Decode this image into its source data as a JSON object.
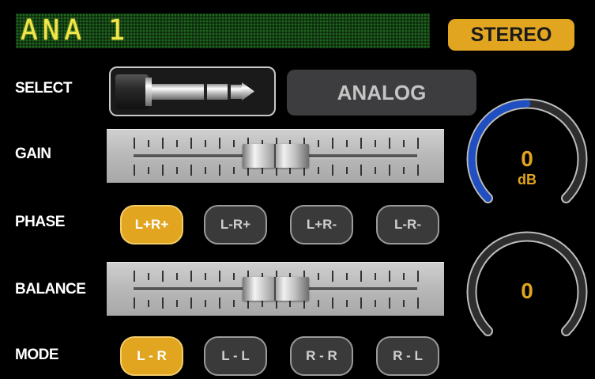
{
  "display": {
    "led_text": "ANA 1"
  },
  "badge": {
    "stereo": "STEREO"
  },
  "labels": {
    "select": "SELECT",
    "gain": "GAIN",
    "phase": "PHASE",
    "balance": "BALANCE",
    "mode": "MODE"
  },
  "select": {
    "source": "ANALOG",
    "connector_icon": "jack-plug-icon"
  },
  "gain": {
    "position_fraction": 0.5
  },
  "balance": {
    "position_fraction": 0.5
  },
  "phase": {
    "options": [
      "L+R+",
      "L-R+",
      "L+R-",
      "L-R-"
    ],
    "selected": 0
  },
  "mode": {
    "options": [
      "L - R",
      "L - L",
      "R - R",
      "R - L"
    ],
    "selected": 0
  },
  "knobs": {
    "gain_value": "0",
    "gain_unit": "dB",
    "gain_fraction": 0.5,
    "balance_value": "0"
  },
  "colors": {
    "accent": "#e2a520",
    "knob_arc_active": "#1f4fc2",
    "led_text": "#f0e84a",
    "led_bg": "#0f2a0f"
  }
}
